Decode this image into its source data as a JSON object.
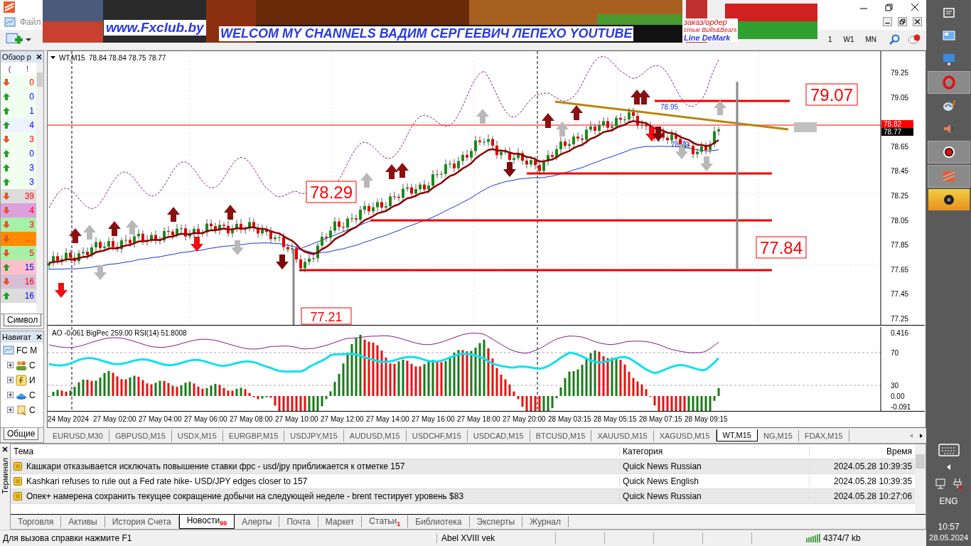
{
  "banner": {
    "site": "www.Fxclub.by",
    "headline": "WELCOM MY CHANNELS ВАДИМ СЕРГЕЕВИЧ ЛЕПЕХО YOUTUBE",
    "notes": [
      "заказ/ордер",
      "стык Bulls&Bears",
      "Line DeMark"
    ]
  },
  "menu": {
    "items": [
      "Файл"
    ]
  },
  "toolbar": {
    "timeframes": [
      "1",
      "W1",
      "MN"
    ]
  },
  "market_watch": {
    "title": "Обзор р",
    "columns": [
      "(",
      "!"
    ],
    "tab": "Символ",
    "rows": [
      {
        "rising": false,
        "value": "0",
        "color": "#f0fff0"
      },
      {
        "rising": true,
        "value": "0",
        "color": "#f0fff0"
      },
      {
        "rising": true,
        "value": "1",
        "color": "#f0fff0"
      },
      {
        "rising": true,
        "value": "4",
        "color": "#eef4ff"
      },
      {
        "rising": false,
        "value": "3",
        "color": "#f0fff0"
      },
      {
        "rising": true,
        "value": "0",
        "color": "#f0fff0"
      },
      {
        "rising": true,
        "value": "3",
        "color": "#f0fff0"
      },
      {
        "rising": true,
        "value": "3",
        "color": "#f0fff0"
      },
      {
        "rising": false,
        "value": "39",
        "color": "#dcdcdc"
      },
      {
        "rising": false,
        "value": "4",
        "color": "#dda0dd"
      },
      {
        "rising": false,
        "value": "3",
        "color": "#a8f0a8"
      },
      {
        "rising": false,
        "value": "…",
        "color": "#ff8c00"
      },
      {
        "rising": false,
        "value": "5",
        "color": "#a8f0a8"
      },
      {
        "rising": true,
        "value": "15",
        "color": "#ffc0cb"
      },
      {
        "rising": false,
        "value": "16",
        "color": "#d8bfd8"
      },
      {
        "rising": true,
        "value": "16",
        "color": "#dcdcdc"
      }
    ]
  },
  "navigator": {
    "title": "Навигат",
    "root": "FC M",
    "tab": "Общие",
    "items": [
      {
        "kind": "accounts",
        "label": "С"
      },
      {
        "kind": "indicators",
        "label": "И"
      },
      {
        "kind": "experts",
        "label": "С"
      },
      {
        "kind": "scripts",
        "label": "С"
      }
    ]
  },
  "chart": {
    "symbol": "WT,M15",
    "quote": "78.84 78.84 78.75 78.77",
    "price_ticks": [
      "79.25",
      "79.05",
      "78.65",
      "78.45",
      "78.25",
      "78.05",
      "77.85",
      "77.65",
      "77.45",
      "77.25"
    ],
    "bid": "78.82",
    "ask": "78.77",
    "level_labels": [
      "79.07",
      "78.29",
      "77.84",
      "77.21"
    ],
    "small_labels": [
      "78.95",
      "78.79"
    ]
  },
  "indicator": {
    "legend": "AO -0.061  BigPec 259.00  RSI(14) 51.8008",
    "ticks": [
      "0.416",
      "70",
      "30",
      "0.00",
      "-0.091"
    ]
  },
  "time_axis": [
    "24 May 2024",
    "27 May 02:00",
    "27 May 04:00",
    "27 May 06:00",
    "27 May 08:00",
    "27 May 10:00",
    "27 May 12:00",
    "27 May 14:00",
    "27 May 16:00",
    "27 May 18:00",
    "27 May 20:00",
    "28 May 03:15",
    "28 May 05:15",
    "28 May 07:15",
    "28 May 09:15"
  ],
  "chart_tabs": [
    {
      "label": "EURUSD,M30",
      "selected": false
    },
    {
      "label": "GBPUSD,M15",
      "selected": false
    },
    {
      "label": "USDX,M15",
      "selected": false
    },
    {
      "label": "EURGBP,M15",
      "selected": false
    },
    {
      "label": "USDJPY,M15",
      "selected": false
    },
    {
      "label": "AUDUSD,M15",
      "selected": false
    },
    {
      "label": "USDCHF,M15",
      "selected": false
    },
    {
      "label": "USDCAD,M15",
      "selected": false
    },
    {
      "label": "BTCUSD,M15",
      "selected": false
    },
    {
      "label": "XAUUSD,M15",
      "selected": false
    },
    {
      "label": "XAGUSD,M15",
      "selected": false
    },
    {
      "label": "WT,M15",
      "selected": true
    },
    {
      "label": "NG,M15",
      "selected": false
    },
    {
      "label": "FDAX,M15",
      "selected": false
    }
  ],
  "terminal": {
    "title": "Терминал",
    "columns": [
      "Тема",
      "Категория",
      "Время"
    ],
    "rows": [
      {
        "subject": "Кашкари отказывается исключать повышение ставки фрс - usd/jpy приближается к отметке 157",
        "category": "Quick News Russian",
        "time": "2024.05.28 10:39:35"
      },
      {
        "subject": "Kashkari refuses to rule out a Fed rate hike- USD/JPY edges closer to 157",
        "category": "Quick News English",
        "time": "2024.05.28 10:39:35"
      },
      {
        "subject": "Опек+ намерена сохранить текущее сокращение добычи на следующей неделе - brent тестирует уровень $83",
        "category": "Quick News Russian",
        "time": "2024.05.28 10:27:06"
      }
    ],
    "tabs": [
      {
        "label": "Торговля",
        "selected": false
      },
      {
        "label": "Активы",
        "selected": false
      },
      {
        "label": "История Счета",
        "selected": false
      },
      {
        "label": "Новости",
        "badge": "99",
        "selected": true
      },
      {
        "label": "Алерты",
        "selected": false
      },
      {
        "label": "Почта",
        "selected": false
      },
      {
        "label": "Маркет",
        "selected": false
      },
      {
        "label": "Статьи",
        "badge": "1",
        "selected": false
      },
      {
        "label": "Библиотека",
        "selected": false
      },
      {
        "label": "Эксперты",
        "selected": false
      },
      {
        "label": "Журнал",
        "selected": false
      }
    ]
  },
  "status_bar": {
    "help": "Для вызова справки нажмите F1",
    "profile": "Abel XVIII vek",
    "traffic": "4374/7 kb"
  },
  "taskbar": {
    "language": "ENG",
    "time": "10:57",
    "date": "28.05.2024"
  }
}
